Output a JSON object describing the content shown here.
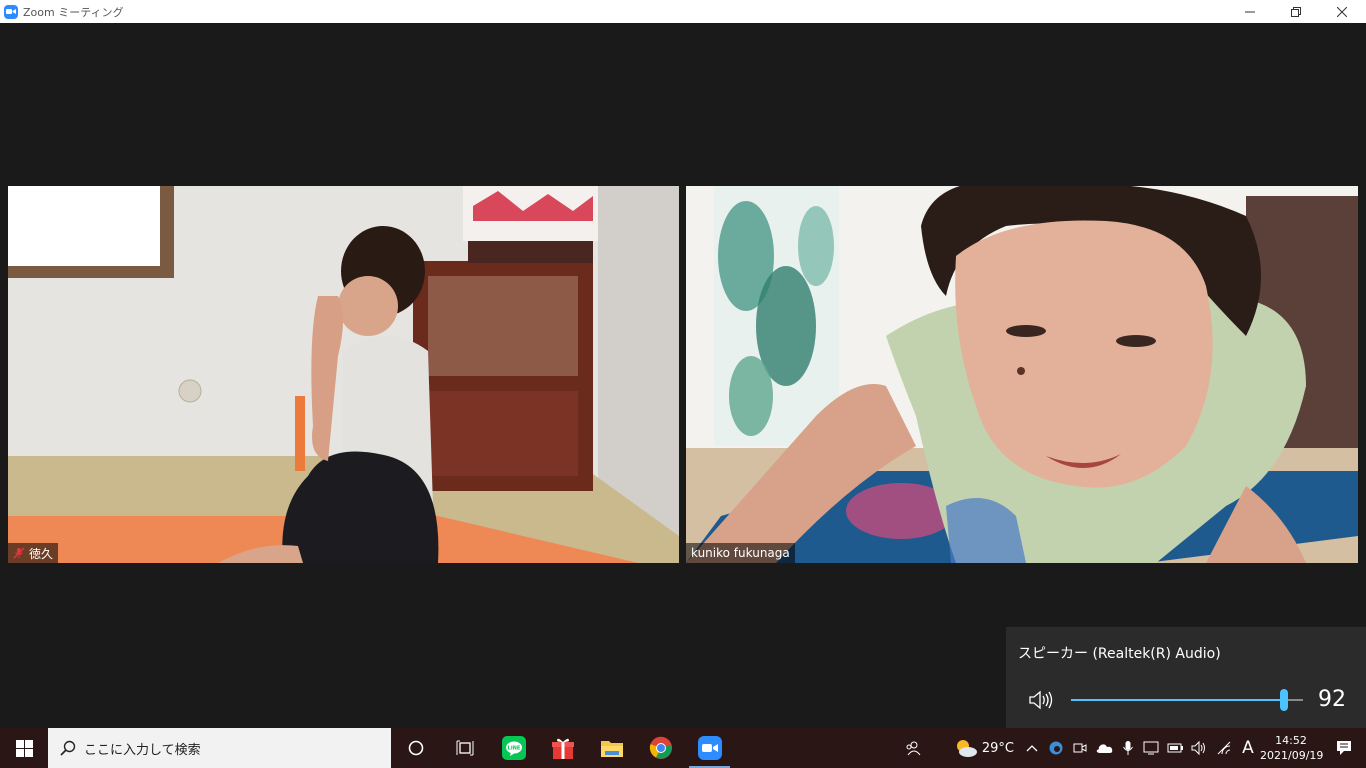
{
  "window": {
    "title": "Zoom ミーティング"
  },
  "participants": [
    {
      "name": "徳久",
      "muted": true
    },
    {
      "name": "kuniko fukunaga",
      "muted": false
    }
  ],
  "volume": {
    "device": "スピーカー (Realtek(R) Audio)",
    "level": 92,
    "accent": "#4cc2ff"
  },
  "taskbar": {
    "search_placeholder": "ここに入力して検索",
    "apps": [
      "cortana-icon",
      "task-view-icon",
      "line-icon",
      "gift-app-icon",
      "file-explorer-icon",
      "chrome-icon",
      "zoom-icon"
    ],
    "weather_temp": "29°C",
    "ime_mode": "A",
    "time": "14:52",
    "date": "2021/09/19"
  }
}
